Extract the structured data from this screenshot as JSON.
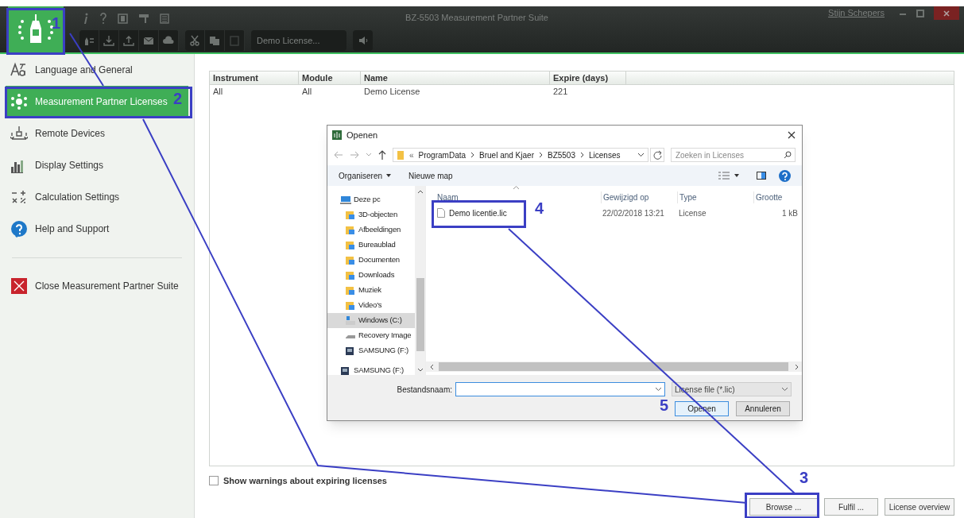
{
  "window": {
    "title": "BZ-5503 Measurement Partner Suite",
    "user": "Stijn Schepers",
    "license_field": "Demo License..."
  },
  "sidebar": {
    "items": [
      {
        "label": "Language and General",
        "kind": "language",
        "selected": false
      },
      {
        "label": "Measurement Partner Licenses",
        "kind": "licenses",
        "selected": true
      },
      {
        "label": "Remote Devices",
        "kind": "remote",
        "selected": false
      },
      {
        "label": "Display Settings",
        "kind": "display",
        "selected": false
      },
      {
        "label": "Calculation Settings",
        "kind": "calc",
        "selected": false
      },
      {
        "label": "Help and Support",
        "kind": "help",
        "selected": false
      }
    ],
    "close_item": {
      "label": "Close Measurement Partner Suite"
    }
  },
  "table": {
    "columns": [
      "Instrument",
      "Module",
      "Name",
      "Expire (days)"
    ],
    "rows": [
      [
        "All",
        "All",
        "Demo License",
        "221"
      ]
    ]
  },
  "warning_checkbox": {
    "label": "Show warnings about expiring licenses",
    "checked": false
  },
  "buttons": [
    "Browse ...",
    "Fulfil ...",
    "License overview"
  ],
  "dialog": {
    "title": "Openen",
    "path_overflow": "«",
    "path": [
      "ProgramData",
      "Bruel and Kjaer",
      "BZ5503",
      "Licenses"
    ],
    "search": {
      "placeholder": "Zoeken in Licenses"
    },
    "commands": [
      "Organiseren",
      "Nieuwe map"
    ],
    "nav": [
      {
        "label": "Deze pc",
        "kind": "pc",
        "selected": false,
        "children": [
          {
            "label": "3D-objecten",
            "kind": "folder",
            "selected": false
          },
          {
            "label": "Afbeeldingen",
            "kind": "folder",
            "selected": false
          },
          {
            "label": "Bureaublad",
            "kind": "folder",
            "selected": false
          },
          {
            "label": "Documenten",
            "kind": "folder",
            "selected": false
          },
          {
            "label": "Downloads",
            "kind": "folder",
            "selected": false
          },
          {
            "label": "Muziek",
            "kind": "folder",
            "selected": false
          },
          {
            "label": "Video's",
            "kind": "folder",
            "selected": false
          },
          {
            "label": "Windows (C:)",
            "kind": "drive",
            "selected": true
          },
          {
            "label": "Recovery Image",
            "kind": "disk",
            "selected": false
          },
          {
            "label": "SAMSUNG (F:)",
            "kind": "usb",
            "selected": false
          }
        ]
      },
      {
        "label": "SAMSUNG (F:)",
        "kind": "usb",
        "selected": false
      }
    ],
    "file_columns": [
      "Naam",
      "Gewijzigd op",
      "Type",
      "Grootte"
    ],
    "files": [
      [
        "Demo licentie.lic",
        "22/02/2018 13:21",
        "License",
        "1 kB"
      ]
    ],
    "filename_label": "Bestandsnaam:",
    "filetype": "License file (*.lic)",
    "buttons": [
      "Openen",
      "Annuleren"
    ]
  },
  "annotations": [
    "1",
    "2",
    "3",
    "4",
    "5"
  ]
}
